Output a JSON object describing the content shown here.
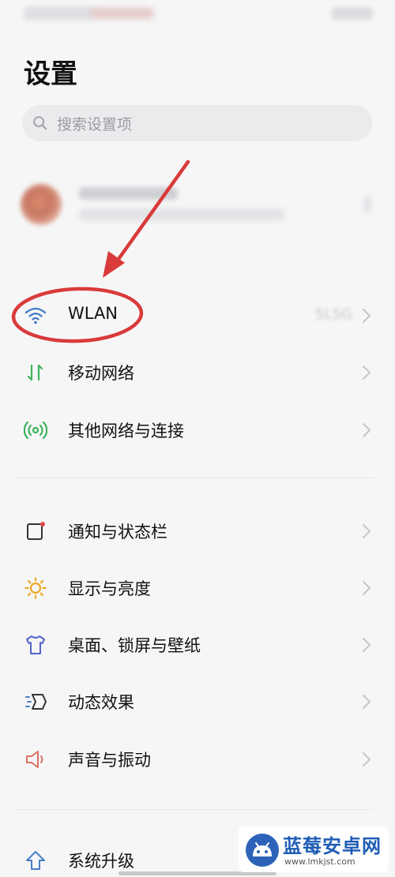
{
  "header": {
    "title": "设置"
  },
  "search": {
    "placeholder": "搜索设置项"
  },
  "network": {
    "wlan": {
      "label": "WLAN",
      "value": "5L5G"
    },
    "mobile": {
      "label": "移动网络"
    },
    "other": {
      "label": "其他网络与连接"
    }
  },
  "display_group": {
    "notifications": {
      "label": "通知与状态栏"
    },
    "display": {
      "label": "显示与亮度"
    },
    "desktop": {
      "label": "桌面、锁屏与壁纸"
    },
    "effects": {
      "label": "动态效果"
    },
    "sound": {
      "label": "声音与振动"
    }
  },
  "system": {
    "upgrade": {
      "label": "系统升级"
    }
  },
  "watermark": {
    "title": "蓝莓安卓网",
    "url": "www.lmkjst.com"
  },
  "icons": {
    "wlan": "wifi-icon",
    "mobile": "mobile-data-icon",
    "other": "wireless-connect-icon",
    "notifications": "notification-icon",
    "display": "sun-icon",
    "desktop": "tshirt-icon",
    "effects": "motion-effect-icon",
    "sound": "speaker-icon",
    "upgrade": "upgrade-arrow-icon"
  },
  "colors": {
    "annotation": "#d93a3a",
    "wifi": "#3b78c9",
    "mobile": "#3cb35a",
    "other": "#3cb35a",
    "notify_dot": "#e54646",
    "sun": "#f0a623",
    "tshirt": "#5565c7",
    "speaker": "#e0705f",
    "upgrade": "#4a7ec9"
  }
}
